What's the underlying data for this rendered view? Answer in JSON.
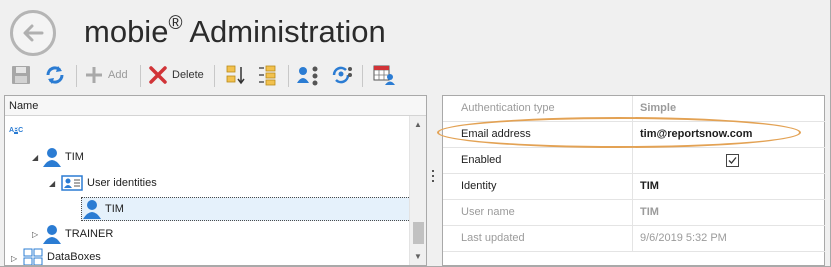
{
  "header": {
    "title": "mobie",
    "title_mark": "®",
    "title_rest": " Administration"
  },
  "toolbar": {
    "add_label": "Add",
    "delete_label": "Delete"
  },
  "tree": {
    "column_header": "Name",
    "nodes": [
      {
        "label": "",
        "icon": "abc-sort-icon"
      },
      {
        "label": "TIM",
        "icon": "user-icon"
      },
      {
        "label": "User identities",
        "icon": "id-card-icon"
      },
      {
        "label": "TIM",
        "icon": "user-icon"
      },
      {
        "label": "TRAINER",
        "icon": "user-icon"
      },
      {
        "label": "DataBoxes",
        "icon": "grid-icon"
      }
    ]
  },
  "properties": [
    {
      "key": "Authentication type",
      "value": "Simple",
      "dim": true
    },
    {
      "key": "Email address",
      "value": "tim@reportsnow.com",
      "dim": false
    },
    {
      "key": "Enabled",
      "value": "",
      "checked": true,
      "dim": false
    },
    {
      "key": "Identity",
      "value": "TIM",
      "dim": false
    },
    {
      "key": "User name",
      "value": "TIM",
      "dim": true
    },
    {
      "key": "Last updated",
      "value": "9/6/2019 5:32 PM",
      "dim": true
    }
  ],
  "colors": {
    "accent_blue": "#2b7cd3",
    "highlight_ring": "#e3a254",
    "delete_red": "#d13438"
  }
}
